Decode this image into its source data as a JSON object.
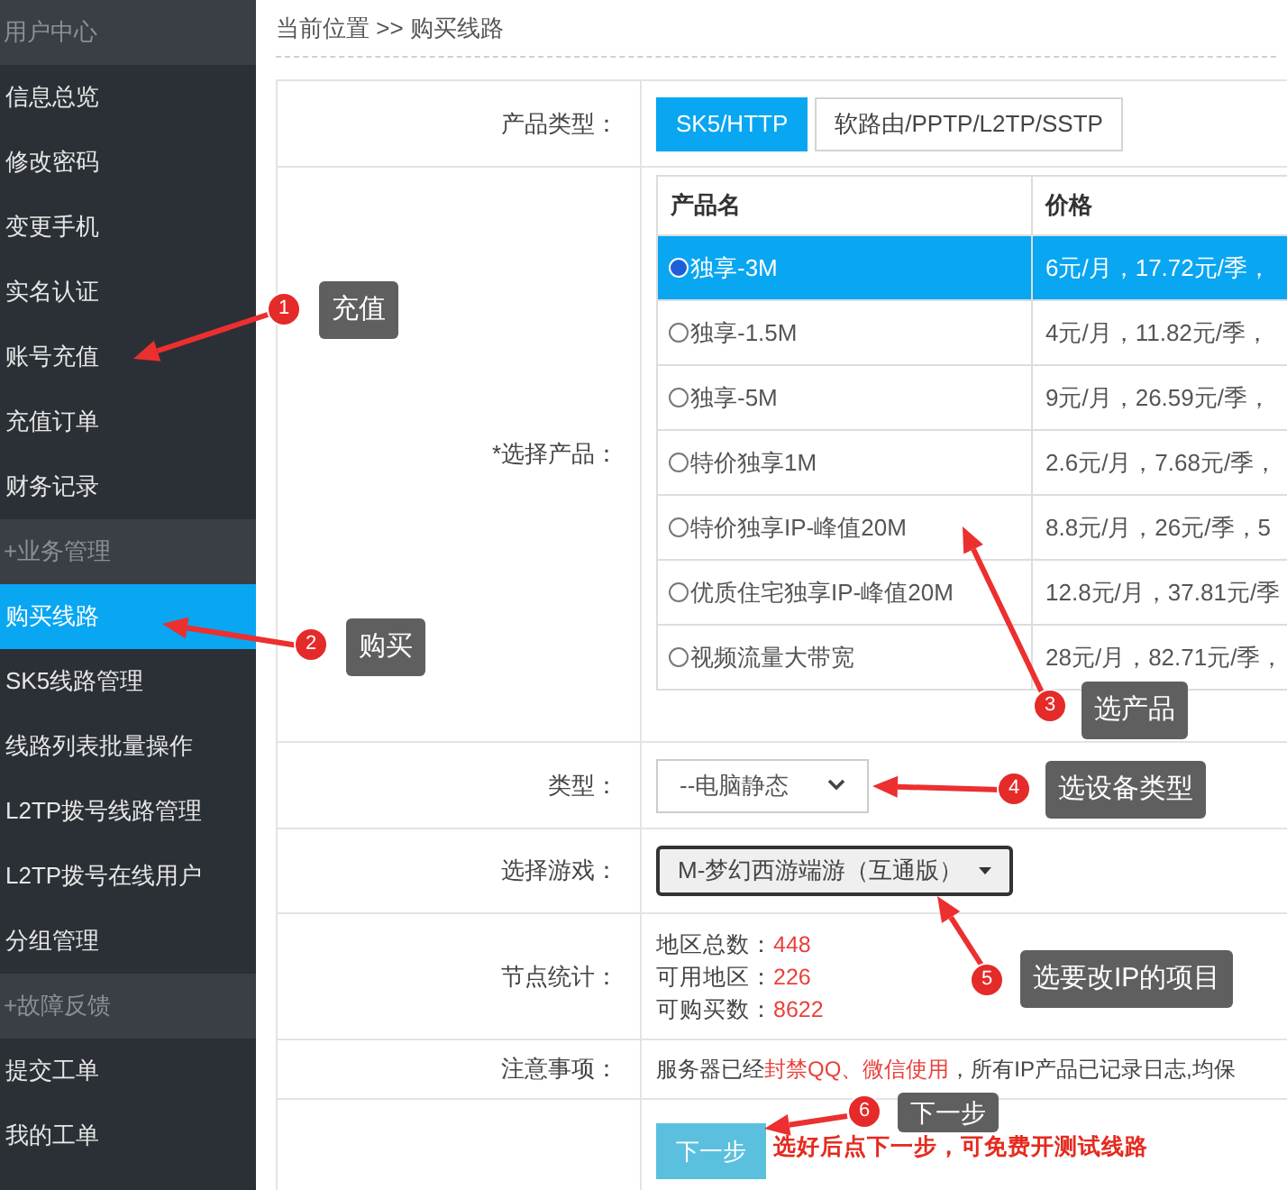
{
  "sidebar": {
    "sections": [
      {
        "title": "用户中心",
        "items": [
          {
            "label": "信息总览",
            "selected": false
          },
          {
            "label": "修改密码",
            "selected": false
          },
          {
            "label": "变更手机",
            "selected": false
          },
          {
            "label": "实名认证",
            "selected": false
          },
          {
            "label": "账号充值",
            "selected": false
          },
          {
            "label": "充值订单",
            "selected": false
          },
          {
            "label": "财务记录",
            "selected": false
          }
        ]
      },
      {
        "title": "+业务管理",
        "items": [
          {
            "label": "购买线路",
            "selected": true
          },
          {
            "label": "SK5线路管理",
            "selected": false
          },
          {
            "label": "线路列表批量操作",
            "selected": false
          },
          {
            "label": "L2TP拨号线路管理",
            "selected": false
          },
          {
            "label": "L2TP拨号在线用户",
            "selected": false
          },
          {
            "label": "分组管理",
            "selected": false
          }
        ]
      },
      {
        "title": "+故障反馈",
        "items": [
          {
            "label": "提交工单",
            "selected": false
          },
          {
            "label": "我的工单",
            "selected": false
          }
        ]
      }
    ]
  },
  "breadcrumb": "当前位置 >> 购买线路",
  "product_type": {
    "label": "产品类型：",
    "options": [
      {
        "label": "SK5/HTTP",
        "selected": true
      },
      {
        "label": "软路由/PPTP/L2TP/SSTP",
        "selected": false
      }
    ]
  },
  "product": {
    "label": "*选择产品：",
    "columns": [
      "产品名",
      "价格"
    ],
    "rows": [
      {
        "name": "独享-3M",
        "price": "6元/月，17.72元/季，",
        "selected": true
      },
      {
        "name": "独享-1.5M",
        "price": "4元/月，11.82元/季，",
        "selected": false
      },
      {
        "name": "独享-5M",
        "price": "9元/月，26.59元/季，",
        "selected": false
      },
      {
        "name": "特价独享1M",
        "price": "2.6元/月，7.68元/季，",
        "selected": false
      },
      {
        "name": "特价独享IP-峰值20M",
        "price": "8.8元/月，26元/季，5",
        "selected": false
      },
      {
        "name": "优质住宅独享IP-峰值20M",
        "price": "12.8元/月，37.81元/季",
        "selected": false
      },
      {
        "name": "视频流量大带宽",
        "price": "28元/月，82.71元/季，",
        "selected": false
      }
    ]
  },
  "device_type": {
    "label": "类型：",
    "value": "--电脑静态"
  },
  "game": {
    "label": "选择游戏：",
    "value": "M-梦幻西游端游（互通版）"
  },
  "node_stats": {
    "label": "节点统计：",
    "items": [
      {
        "label": "地区总数：",
        "value": "448"
      },
      {
        "label": "可用地区：",
        "value": "226"
      },
      {
        "label": "可购买数：",
        "value": "8622"
      }
    ]
  },
  "notice": {
    "label": "注意事项：",
    "parts": [
      {
        "text": "服务器已经",
        "highlight": false
      },
      {
        "text": "封禁QQ、微信使用",
        "highlight": true
      },
      {
        "text": "，所有IP产品已记录日志,均保",
        "highlight": false
      }
    ]
  },
  "submit": {
    "button": "下一步",
    "hint": "选好后点下一步，可免费开测试线路"
  },
  "annotations": [
    {
      "number": "1",
      "label": "充值"
    },
    {
      "number": "2",
      "label": "购买"
    },
    {
      "number": "3",
      "label": "选产品"
    },
    {
      "number": "4",
      "label": "选设备类型"
    },
    {
      "number": "5",
      "label": "选要改IP的项目"
    },
    {
      "number": "6",
      "label": "下一步"
    }
  ]
}
